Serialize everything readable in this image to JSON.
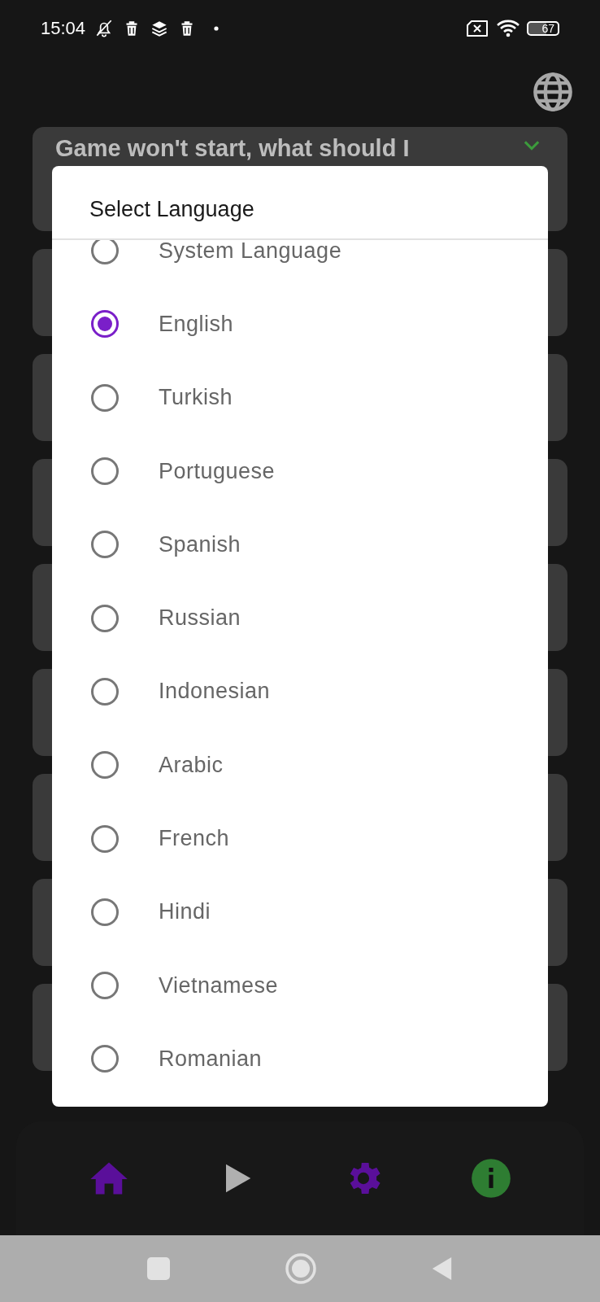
{
  "status_bar": {
    "time": "15:04",
    "left_icons": [
      {
        "kind": "bell-off"
      },
      {
        "kind": "trash"
      },
      {
        "kind": "layers"
      },
      {
        "kind": "trash"
      },
      {
        "kind": "dot"
      }
    ],
    "battery": "67"
  },
  "cards": [
    {
      "title": "Game won't start, what should I"
    }
  ],
  "dialog": {
    "title": "Select Language",
    "options": [
      {
        "label": "System Language",
        "selected": false
      },
      {
        "label": "English",
        "selected": true
      },
      {
        "label": "Turkish",
        "selected": false
      },
      {
        "label": "Portuguese",
        "selected": false
      },
      {
        "label": "Spanish",
        "selected": false
      },
      {
        "label": "Russian",
        "selected": false
      },
      {
        "label": "Indonesian",
        "selected": false
      },
      {
        "label": "Arabic",
        "selected": false
      },
      {
        "label": "French",
        "selected": false
      },
      {
        "label": "Hindi",
        "selected": false
      },
      {
        "label": "Vietnamese",
        "selected": false
      },
      {
        "label": "Romanian",
        "selected": false
      }
    ]
  },
  "bottom_nav": [
    {
      "kind": "home",
      "color": "#5a0f9a"
    },
    {
      "kind": "play",
      "color": "#b0b0b0"
    },
    {
      "kind": "gear",
      "color": "#5a0f9a"
    },
    {
      "kind": "info",
      "color": "#2e7d32"
    }
  ]
}
